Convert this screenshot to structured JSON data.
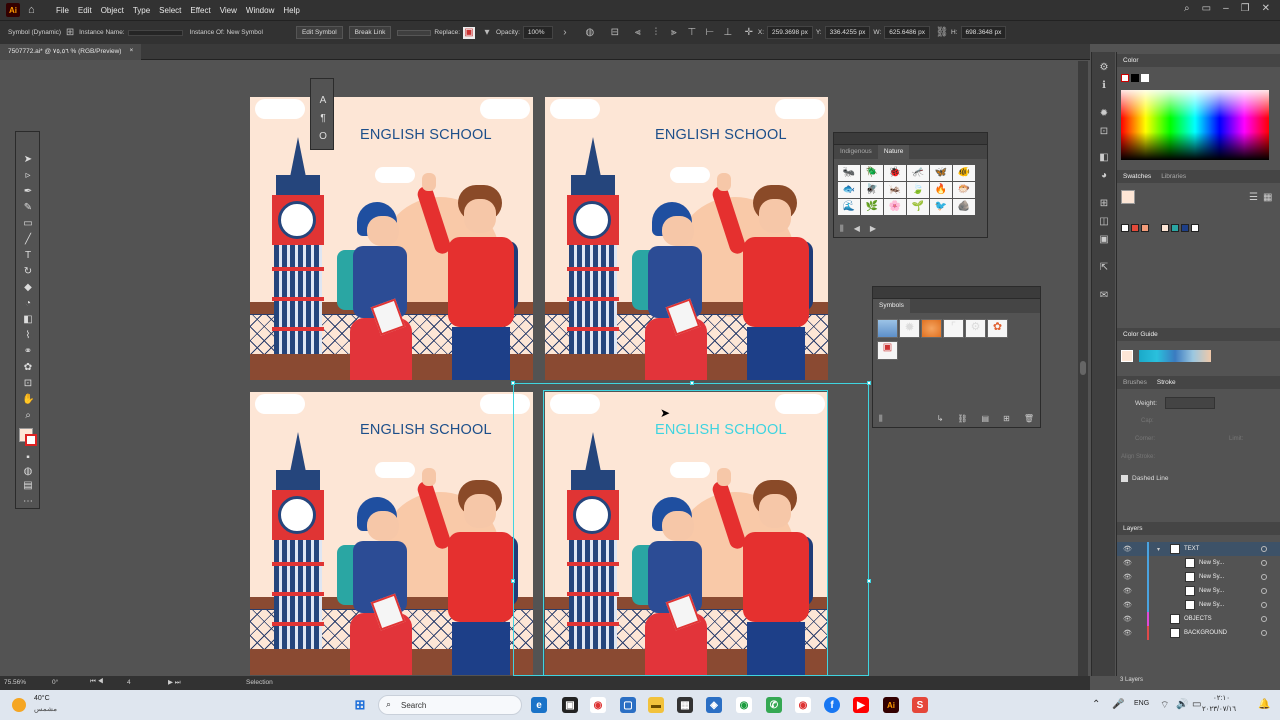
{
  "app": {
    "logo": "Ai"
  },
  "menu": [
    "File",
    "Edit",
    "Object",
    "Type",
    "Select",
    "Effect",
    "View",
    "Window",
    "Help"
  ],
  "control_bar": {
    "object_type": "Symbol (Dynamic)",
    "instance_name_label": "Instance Name:",
    "instance_of": "Instance Of: New Symbol",
    "edit_symbol": "Edit Symbol",
    "break_link": "Break Link",
    "replace_label": "Replace:",
    "opacity_label": "Opacity:",
    "opacity_value": "100%",
    "x_label": "X:",
    "x_value": "259.3698 px",
    "y_label": "Y:",
    "y_value": "336.4255 px",
    "w_label": "W:",
    "w_value": "625.6486 px",
    "h_label": "H:",
    "h_value": "698.3648 px"
  },
  "document_tab": {
    "name": "7507772.ai* @ ٧٥,٥٦ % (RGB/Preview)",
    "close": "×"
  },
  "artboards": {
    "title": "ENGLISH SCHOOL"
  },
  "nature_panel": {
    "tabs": [
      "Indigenous",
      "Nature"
    ],
    "active": "Nature"
  },
  "symbols_panel": {
    "title": "Symbols"
  },
  "right_panels": {
    "color": "Color",
    "swatches": "Swatches",
    "libraries": "Libraries",
    "color_guide": "Color Guide",
    "brushes": "Brushes",
    "stroke": "Stroke",
    "weight_label": "Weight:",
    "cap_label": "Cap:",
    "corner_label": "Corner:",
    "align_label": "Align Stroke:",
    "limit_label": "Limit:",
    "dashed_line": "Dashed Line",
    "layers": "Layers",
    "layers_count": "3 Layers"
  },
  "layers": [
    {
      "name": "TEXT",
      "color": "#4aa3e0"
    },
    {
      "name": "New Sy...",
      "color": "#4aa3e0"
    },
    {
      "name": "New Sy...",
      "color": "#4aa3e0"
    },
    {
      "name": "New Sy...",
      "color": "#4aa3e0"
    },
    {
      "name": "New Sy...",
      "color": "#4aa3e0"
    },
    {
      "name": "OBJECTS",
      "color": "#e04ad8"
    },
    {
      "name": "BACKGROUND",
      "color": "#e04a4a"
    }
  ],
  "status_bar": {
    "zoom": "75.56%",
    "rotation": "0°",
    "artboard": "4",
    "tool": "Selection"
  },
  "taskbar": {
    "weather_temp": "40°C",
    "weather_desc": "مشمس",
    "search_placeholder": "Search",
    "lang": "ENG",
    "time": "٠٢:١٠",
    "date": "٢٠٢٣/٠٧/١٦"
  },
  "colors": {
    "accent": "#3fd4e0",
    "title_blue": "#1d4f8a",
    "menubar": "#323232"
  }
}
